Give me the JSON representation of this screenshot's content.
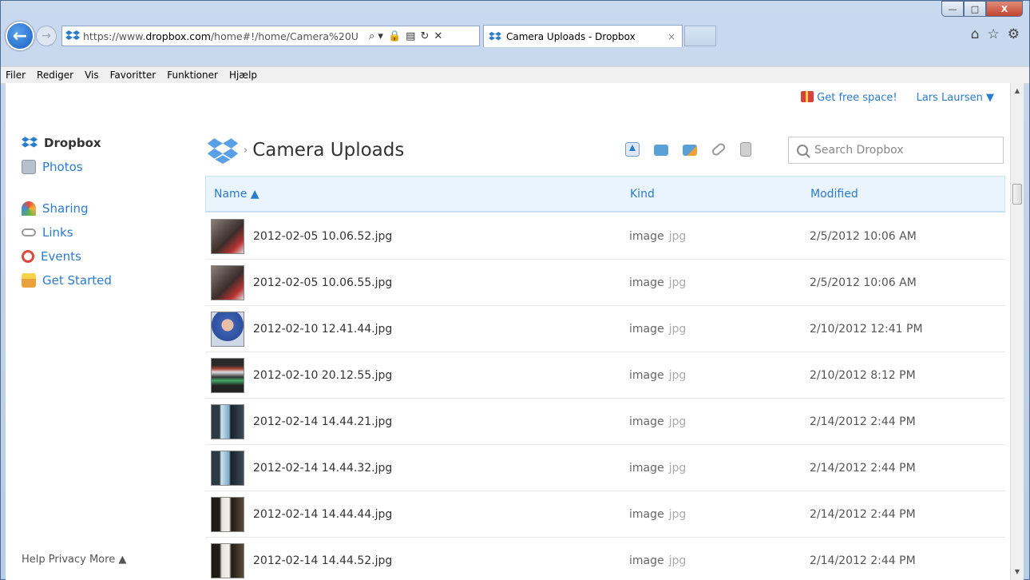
{
  "browser": {
    "url_prefix": "https://www.",
    "url_domain": "dropbox.com",
    "url_rest": "/home#!/home/Camera%20U",
    "tab_title": "Camera Uploads - Dropbox",
    "tab_close": "×",
    "addr_tools": [
      "⌕ ▾",
      "🔒",
      "▤",
      "↻",
      "✕"
    ],
    "right_icons": [
      "⌂",
      "☆",
      "⚙"
    ],
    "window_controls": {
      "minimize": "—",
      "maximize": "□",
      "close": "X"
    }
  },
  "menu": [
    "Filer",
    "Rediger",
    "Vis",
    "Favoritter",
    "Funktioner",
    "Hjælp"
  ],
  "topbar": {
    "free_space": "Get free space!",
    "user": "Lars Laursen ▼"
  },
  "sidebar": {
    "items": [
      {
        "label": "Dropbox",
        "icon": "dropbox-icon",
        "color": "#2b7bcf"
      },
      {
        "label": "Photos",
        "icon": "photos-icon",
        "color": "#9aa6b5"
      },
      {
        "label": "Sharing",
        "icon": "rainbow-icon",
        "color": "#e9a23b"
      },
      {
        "label": "Links",
        "icon": "chain-link-icon",
        "color": "#999999"
      },
      {
        "label": "Events",
        "icon": "clock-icon",
        "color": "#e0463c"
      },
      {
        "label": "Get Started",
        "icon": "cake-icon",
        "color": "#f2b44a"
      }
    ],
    "footer": "Help Privacy More ▲"
  },
  "header": {
    "arrow": "›",
    "title": "Camera Uploads",
    "search_placeholder": "Search Dropbox"
  },
  "columns": {
    "name": "Name ▲",
    "kind": "Kind",
    "modified": "Modified"
  },
  "files": [
    {
      "name": "2012-02-05 10.06.52.jpg",
      "kind": "image",
      "ext": "jpg",
      "modified": "2/5/2012 10:06 AM"
    },
    {
      "name": "2012-02-05 10.06.55.jpg",
      "kind": "image",
      "ext": "jpg",
      "modified": "2/5/2012 10:06 AM"
    },
    {
      "name": "2012-02-10 12.41.44.jpg",
      "kind": "image",
      "ext": "jpg",
      "modified": "2/10/2012 12:41 PM"
    },
    {
      "name": "2012-02-10 20.12.55.jpg",
      "kind": "image",
      "ext": "jpg",
      "modified": "2/10/2012 8:12 PM"
    },
    {
      "name": "2012-02-14 14.44.21.jpg",
      "kind": "image",
      "ext": "jpg",
      "modified": "2/14/2012 2:44 PM"
    },
    {
      "name": "2012-02-14 14.44.32.jpg",
      "kind": "image",
      "ext": "jpg",
      "modified": "2/14/2012 2:44 PM"
    },
    {
      "name": "2012-02-14 14.44.44.jpg",
      "kind": "image",
      "ext": "jpg",
      "modified": "2/14/2012 2:44 PM"
    },
    {
      "name": "2012-02-14 14.44.52.jpg",
      "kind": "image",
      "ext": "jpg",
      "modified": "2/14/2012 2:44 PM"
    }
  ]
}
